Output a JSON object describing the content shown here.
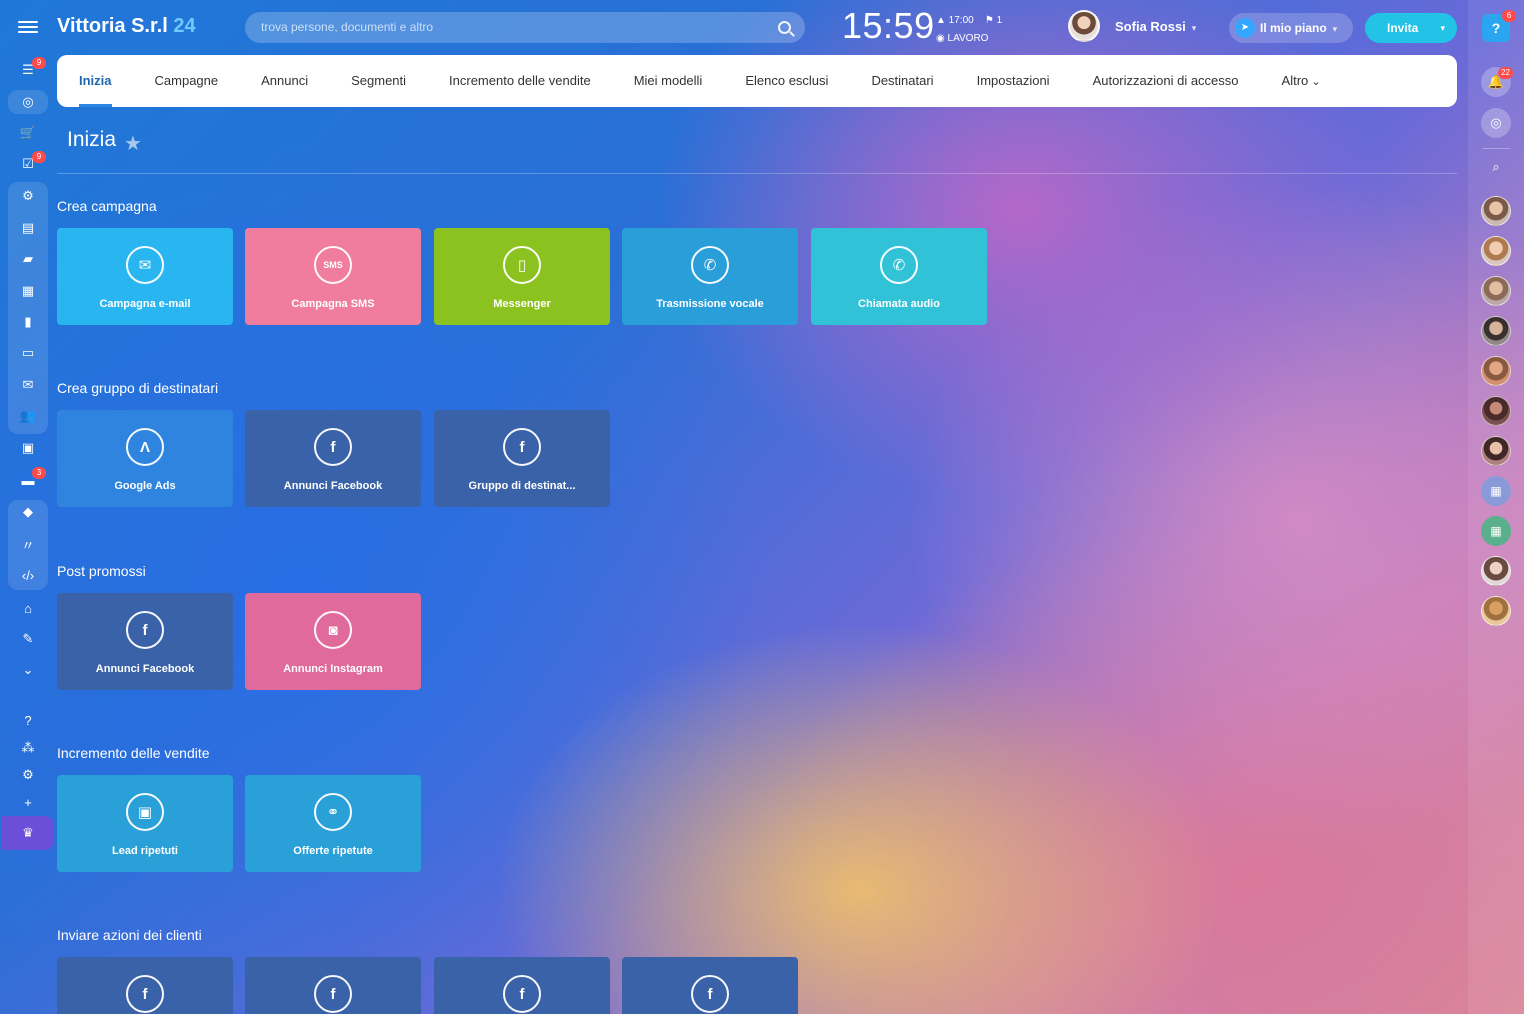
{
  "header": {
    "brand_name": "Vittoria S.r.l",
    "brand_number": "24",
    "search_placeholder": "trova persone, documenti e altro",
    "clock": "15:59",
    "clock_alarm": "▲ 17:00",
    "clock_flag": "⚑ 1",
    "work_status": "◉ LAVORO",
    "user_name": "Sofia Rossi",
    "plan_label": "Il mio piano",
    "invite_label": "Invita"
  },
  "leftbar": {
    "badges": [
      "9",
      "9",
      "3"
    ]
  },
  "rightbar": {
    "help_label": "?",
    "notifications_badge": "22",
    "help_badge": "6"
  },
  "tabs": [
    {
      "label": "Inizia",
      "active": true
    },
    {
      "label": "Campagne"
    },
    {
      "label": "Annunci"
    },
    {
      "label": "Segmenti"
    },
    {
      "label": "Incremento delle vendite"
    },
    {
      "label": "Miei modelli"
    },
    {
      "label": "Elenco esclusi"
    },
    {
      "label": "Destinatari"
    },
    {
      "label": "Impostazioni"
    },
    {
      "label": "Autorizzazioni di accesso"
    },
    {
      "label": "Altro"
    }
  ],
  "page": {
    "title": "Inizia"
  },
  "sections": [
    {
      "title": "Crea campagna",
      "tiles": [
        {
          "label": "Campagna e-mail",
          "icon": "email-icon",
          "color": "#29b6f0"
        },
        {
          "label": "Campagna SMS",
          "icon": "sms-icon",
          "color": "#f07c9e"
        },
        {
          "label": "Messenger",
          "icon": "mobile-icon",
          "color": "#8cc220"
        },
        {
          "label": "Trasmissione vocale",
          "icon": "voice-call-icon",
          "color": "#2a9ed8"
        },
        {
          "label": "Chiamata audio",
          "icon": "audio-call-icon",
          "color": "#32c2d8"
        }
      ]
    },
    {
      "title": "Crea gruppo di destinatari",
      "tiles": [
        {
          "label": "Google Ads",
          "icon": "google-ads-icon",
          "color": "#2f84e0"
        },
        {
          "label": "Annunci Facebook",
          "icon": "facebook-icon",
          "color": "#3a62a8"
        },
        {
          "label": "Gruppo di destinat...",
          "icon": "facebook-icon",
          "color": "#3a62a8"
        }
      ]
    },
    {
      "title": "Post promossi",
      "tiles": [
        {
          "label": "Annunci Facebook",
          "icon": "facebook-icon",
          "color": "#3a62a8"
        },
        {
          "label": "Annunci Instagram",
          "icon": "instagram-icon",
          "color": "#e06a9c"
        }
      ]
    },
    {
      "title": "Incremento delle vendite",
      "tiles": [
        {
          "label": "Lead ripetuti",
          "icon": "repeat-lead-icon",
          "color": "#2aa0d8"
        },
        {
          "label": "Offerte ripetute",
          "icon": "handshake-icon",
          "color": "#2aa0d8"
        }
      ]
    },
    {
      "title": "Inviare azioni dei clienti",
      "tiles": [
        {
          "label": "",
          "icon": "facebook-icon",
          "color": "#3a62a8"
        },
        {
          "label": "",
          "icon": "facebook-icon",
          "color": "#3a62a8"
        },
        {
          "label": "",
          "icon": "facebook-icon",
          "color": "#3a62a8"
        },
        {
          "label": "",
          "icon": "facebook-icon",
          "color": "#3a62a8"
        }
      ]
    }
  ]
}
